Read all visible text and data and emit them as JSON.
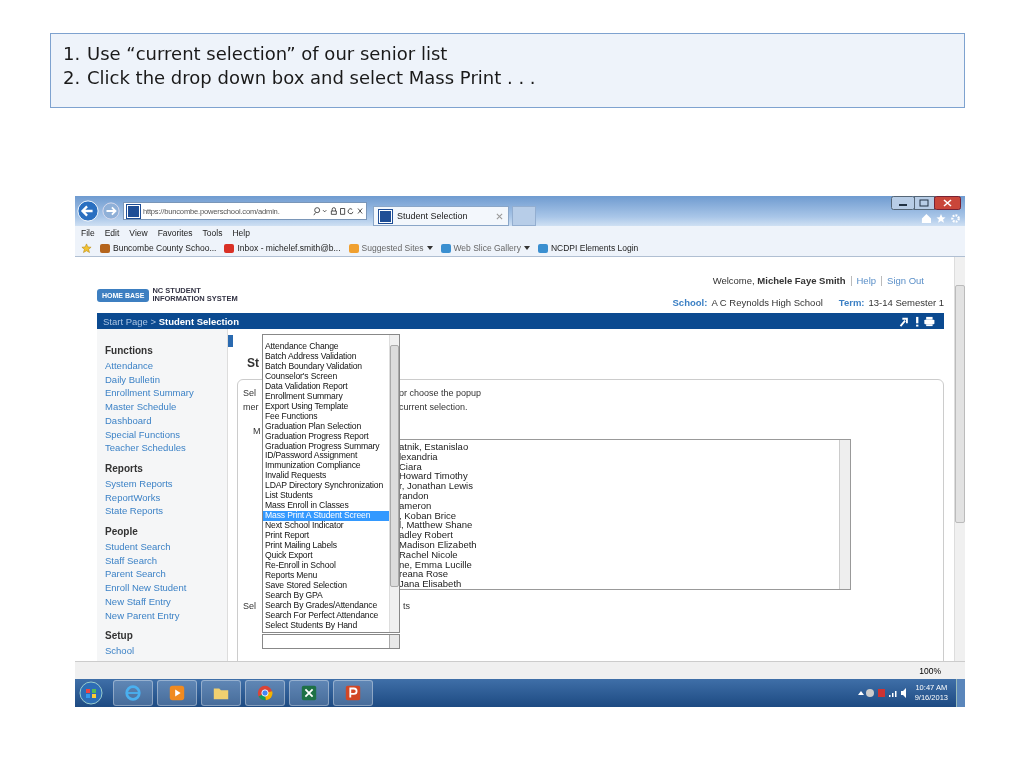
{
  "slide": {
    "steps": [
      {
        "number": "1.",
        "text": "Use “current selection” of our senior list"
      },
      {
        "number": "2.",
        "text": "Click the drop down box and select Mass Print . . ."
      }
    ]
  },
  "browser": {
    "address": "https://buncombe.powerschool.com/admin.",
    "tab": {
      "title": "Student Selection",
      "selected": true
    },
    "menu": [
      "File",
      "Edit",
      "View",
      "Favorites",
      "Tools",
      "Help"
    ],
    "favorites": [
      {
        "kind": "site",
        "label": "Buncombe County Schoo...",
        "dropdown": false
      },
      {
        "kind": "mail",
        "label": "Inbox - michelef.smith@b...",
        "dropdown": false
      },
      {
        "kind": "suggested",
        "label": "Suggested Sites",
        "dropdown": true
      },
      {
        "kind": "page",
        "label": "Web Slice Gallery",
        "dropdown": true
      },
      {
        "kind": "page",
        "label": "NCDPI Elements Login",
        "dropdown": false
      }
    ],
    "zoom": "100%"
  },
  "header": {
    "logo": "HOME BASE",
    "logo_subtitle": [
      "NC STUDENT",
      "INFORMATION SYSTEM"
    ],
    "welcome": "Welcome,",
    "user": "Michele Faye Smith",
    "links": [
      "Help",
      "Sign Out"
    ],
    "school_label": "School:",
    "school": "A C Reynolds High School",
    "term_label": "Term:",
    "term": "13-14 Semester 1"
  },
  "breadcrumb": "Start Page > **Student Selection**",
  "sidebar": [
    {
      "heading": "Functions",
      "items": [
        "Attendance",
        "Daily Bulletin",
        "Enrollment Summary",
        "Master Schedule",
        "Dashboard",
        "Special Functions",
        "Teacher Schedules"
      ]
    },
    {
      "heading": "Reports",
      "items": [
        "System Reports",
        "ReportWorks",
        "State Reports"
      ]
    },
    {
      "heading": "People",
      "items": [
        "Student Search",
        "Staff Search",
        "Parent Search",
        "Enroll New Student",
        "New Staff Entry",
        "New Parent Entry"
      ]
    },
    {
      "heading": "Setup",
      "items": [
        "School"
      ]
    }
  ],
  "main": {
    "heading": "St",
    "rows": [
      {
        "left": "Sel",
        "right": "or choose the popup"
      },
      {
        "left": "mer",
        "right": "current selection."
      }
    ],
    "label": "M",
    "bottom": {
      "left": "Sel",
      "right": "ts"
    }
  },
  "dropdown": {
    "options": [
      {
        "label": "Attendance Change",
        "selected": false
      },
      {
        "label": "Batch Address Validation",
        "selected": false
      },
      {
        "label": "Batch Boundary Validation",
        "selected": false
      },
      {
        "label": "Counselor's Screen",
        "selected": false
      },
      {
        "label": "Data Validation Report",
        "selected": false
      },
      {
        "label": "Enrollment Summary",
        "selected": false
      },
      {
        "label": "Export Using Template",
        "selected": false
      },
      {
        "label": "Fee Functions",
        "selected": false
      },
      {
        "label": "Graduation Plan Selection",
        "selected": false
      },
      {
        "label": "Graduation Progress Report",
        "selected": false
      },
      {
        "label": "Graduation Progress Summary",
        "selected": false
      },
      {
        "label": "ID/Password Assignment",
        "selected": false
      },
      {
        "label": "Immunization Compliance",
        "selected": false
      },
      {
        "label": "Invalid Requests",
        "selected": false
      },
      {
        "label": "LDAP Directory Synchronization",
        "selected": false
      },
      {
        "label": "List Students",
        "selected": false
      },
      {
        "label": "Mass Enroll in Classes",
        "selected": false
      },
      {
        "label": "Mass Print A Student Screen",
        "selected": true
      },
      {
        "label": "Next School Indicator",
        "selected": false
      },
      {
        "label": "Print Report",
        "selected": false
      },
      {
        "label": "Print Mailing Labels",
        "selected": false
      },
      {
        "label": "Quick Export",
        "selected": false
      },
      {
        "label": "Re-Enroll in School",
        "selected": false
      },
      {
        "label": "Reports Menu",
        "selected": false
      },
      {
        "label": "Save Stored Selection",
        "selected": false
      },
      {
        "label": "Search By GPA",
        "selected": false
      },
      {
        "label": "Search By Grades/Attendance",
        "selected": false
      },
      {
        "label": "Search For Perfect Attendance",
        "selected": false
      },
      {
        "label": "Select Students By Hand",
        "selected": false
      }
    ]
  },
  "students": [
    "atnik, Estanislao",
    "lexandria",
    "Ciara",
    "Howard Timothy",
    "r, Jonathan Lewis",
    "randon",
    "ameron",
    ", Koban Brice",
    "l, Matthew Shane",
    "adley Robert",
    "Madison Elizabeth",
    "Rachel Nicole",
    "ne, Emma Lucille",
    "reana Rose",
    "Jana Elisabeth"
  ],
  "taskbar": {
    "time": "10:47 AM",
    "date": "9/16/2013"
  }
}
